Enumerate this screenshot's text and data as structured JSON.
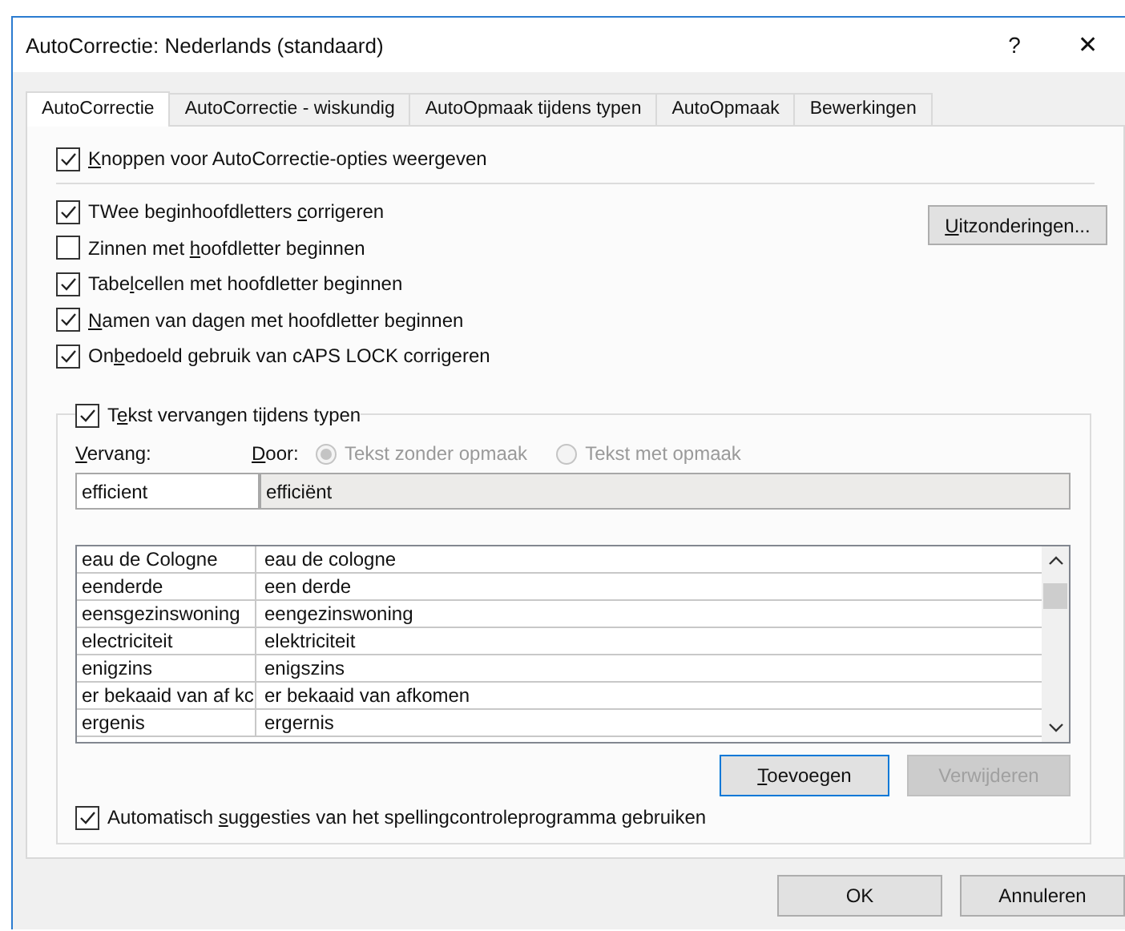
{
  "window": {
    "title": "AutoCorrectie: Nederlands (standaard)",
    "help": "?",
    "close": "✕"
  },
  "tabs": [
    {
      "label": "AutoCorrectie",
      "selected": true
    },
    {
      "label": "AutoCorrectie - wiskundig",
      "selected": false
    },
    {
      "label": "AutoOpmaak tijdens typen",
      "selected": false
    },
    {
      "label": "AutoOpmaak",
      "selected": false
    },
    {
      "label": "Bewerkingen",
      "selected": false
    }
  ],
  "top_option": {
    "key": "K",
    "post": "noppen voor AutoCorrectie-opties weergeven",
    "checked": true
  },
  "options": [
    {
      "pre": "TWee beginhoofdletters ",
      "key": "c",
      "post": "orrigeren",
      "checked": true
    },
    {
      "pre": "Zinnen met ",
      "key": "h",
      "post": "oofdletter beginnen",
      "checked": false
    },
    {
      "pre": "Tabe",
      "key": "l",
      "post": "cellen met hoofdletter beginnen",
      "checked": true
    },
    {
      "key": "N",
      "post": "amen van dagen met hoofdletter beginnen",
      "checked": true
    },
    {
      "pre": "On",
      "key": "b",
      "post": "edoeld gebruik van cAPS LOCK corrigeren",
      "checked": true
    }
  ],
  "exceptions_button": {
    "key": "U",
    "post": "itzonderingen..."
  },
  "replace_option": {
    "pre": "T",
    "key": "e",
    "post": "kst vervangen tijdens typen",
    "checked": true
  },
  "replace_label": {
    "key": "V",
    "post": "ervang:"
  },
  "with_label": {
    "key": "D",
    "post": "oor:"
  },
  "format_radios": [
    {
      "label": "Tekst zonder opmaak",
      "selected": true,
      "disabled": true
    },
    {
      "label": "Tekst met opmaak",
      "selected": false,
      "disabled": true
    }
  ],
  "replace_value": "efficient",
  "with_value": "efficiënt",
  "table": {
    "rows": [
      [
        "eau de Cologne",
        "eau de cologne"
      ],
      [
        "eenderde",
        "een derde"
      ],
      [
        "eensgezinswoning",
        "eengezinswoning"
      ],
      [
        "electriciteit",
        "elektriciteit"
      ],
      [
        "enigzins",
        "enigszins"
      ],
      [
        "er bekaaid van af kc",
        "er bekaaid van afkomen"
      ],
      [
        "ergenis",
        "ergernis"
      ]
    ]
  },
  "action_buttons": [
    {
      "key": "T",
      "post": "oevoegen",
      "disabled": false,
      "default": true
    },
    {
      "post": "Verwijderen",
      "disabled": true,
      "default": false
    }
  ],
  "suggest_option": {
    "pre": "Automatisch ",
    "key": "s",
    "post": "uggesties van het spellingcontroleprogramma gebruiken",
    "checked": true
  },
  "buttons": [
    {
      "label": "OK"
    },
    {
      "label": "Annuleren"
    }
  ]
}
